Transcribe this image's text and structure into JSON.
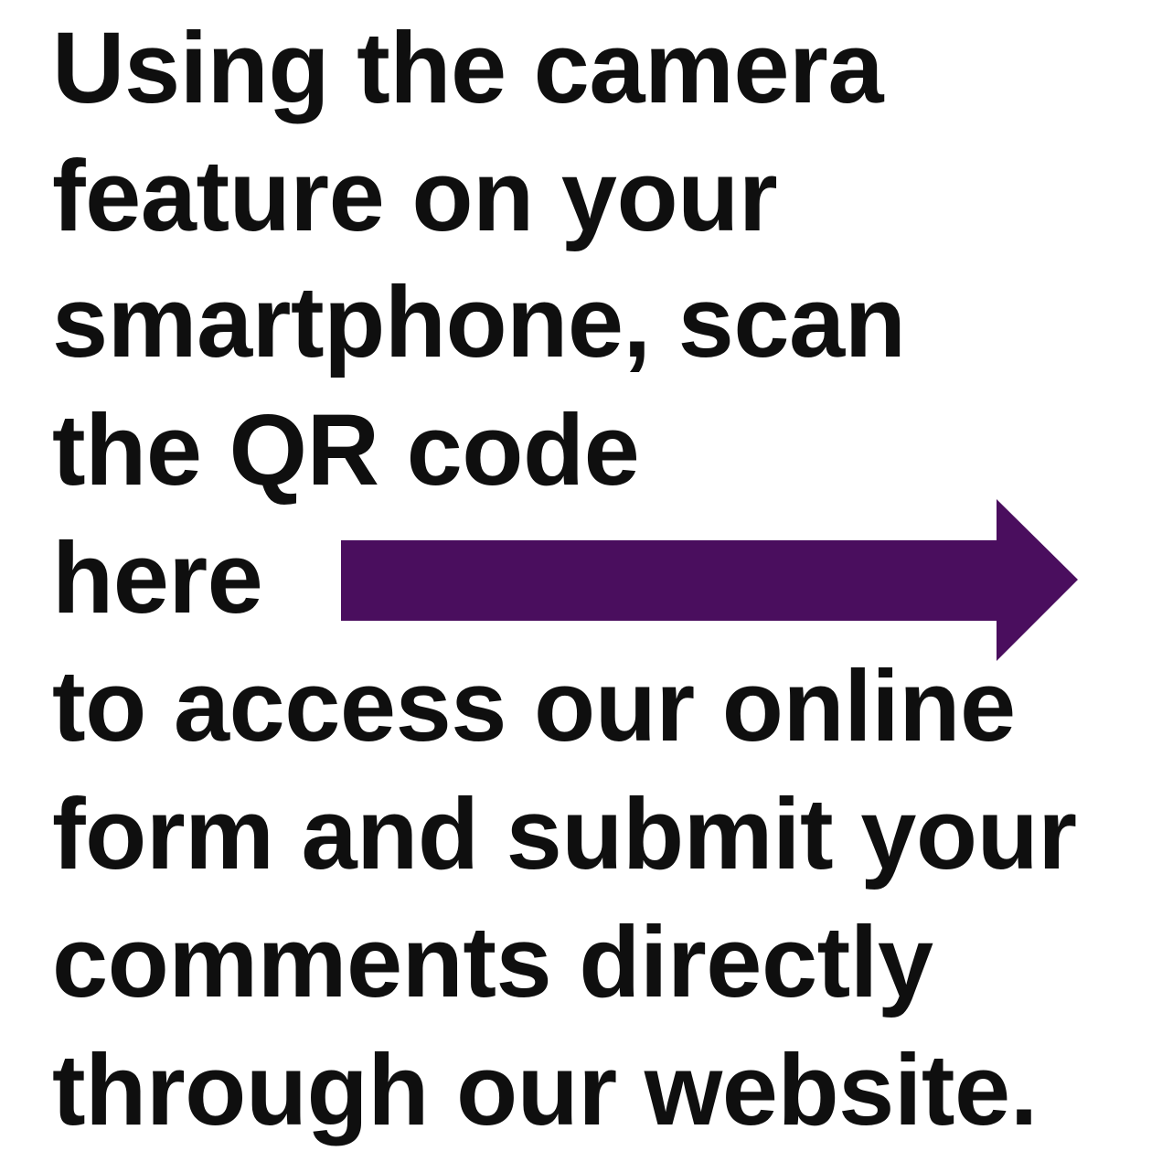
{
  "instructions": {
    "line1": "Using the camera",
    "line2": "feature on your",
    "line3": "smartphone, scan",
    "line4": "the QR code",
    "line5": "here",
    "line6": "to access our online",
    "line7": "form and submit your",
    "line8": "comments directly",
    "line9": "through our website."
  },
  "arrow": {
    "icon": "arrow-right-icon",
    "color": "#4a0e5e"
  }
}
